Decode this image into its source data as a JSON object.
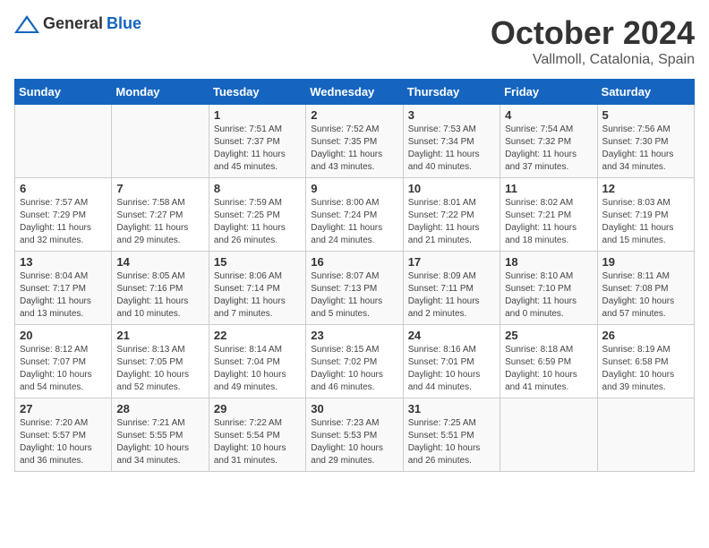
{
  "header": {
    "logo_general": "General",
    "logo_blue": "Blue",
    "month": "October 2024",
    "location": "Vallmoll, Catalonia, Spain"
  },
  "days_of_week": [
    "Sunday",
    "Monday",
    "Tuesday",
    "Wednesday",
    "Thursday",
    "Friday",
    "Saturday"
  ],
  "weeks": [
    [
      {
        "day": "",
        "info": ""
      },
      {
        "day": "",
        "info": ""
      },
      {
        "day": "1",
        "info": "Sunrise: 7:51 AM\nSunset: 7:37 PM\nDaylight: 11 hours and 45 minutes."
      },
      {
        "day": "2",
        "info": "Sunrise: 7:52 AM\nSunset: 7:35 PM\nDaylight: 11 hours and 43 minutes."
      },
      {
        "day": "3",
        "info": "Sunrise: 7:53 AM\nSunset: 7:34 PM\nDaylight: 11 hours and 40 minutes."
      },
      {
        "day": "4",
        "info": "Sunrise: 7:54 AM\nSunset: 7:32 PM\nDaylight: 11 hours and 37 minutes."
      },
      {
        "day": "5",
        "info": "Sunrise: 7:56 AM\nSunset: 7:30 PM\nDaylight: 11 hours and 34 minutes."
      }
    ],
    [
      {
        "day": "6",
        "info": "Sunrise: 7:57 AM\nSunset: 7:29 PM\nDaylight: 11 hours and 32 minutes."
      },
      {
        "day": "7",
        "info": "Sunrise: 7:58 AM\nSunset: 7:27 PM\nDaylight: 11 hours and 29 minutes."
      },
      {
        "day": "8",
        "info": "Sunrise: 7:59 AM\nSunset: 7:25 PM\nDaylight: 11 hours and 26 minutes."
      },
      {
        "day": "9",
        "info": "Sunrise: 8:00 AM\nSunset: 7:24 PM\nDaylight: 11 hours and 24 minutes."
      },
      {
        "day": "10",
        "info": "Sunrise: 8:01 AM\nSunset: 7:22 PM\nDaylight: 11 hours and 21 minutes."
      },
      {
        "day": "11",
        "info": "Sunrise: 8:02 AM\nSunset: 7:21 PM\nDaylight: 11 hours and 18 minutes."
      },
      {
        "day": "12",
        "info": "Sunrise: 8:03 AM\nSunset: 7:19 PM\nDaylight: 11 hours and 15 minutes."
      }
    ],
    [
      {
        "day": "13",
        "info": "Sunrise: 8:04 AM\nSunset: 7:17 PM\nDaylight: 11 hours and 13 minutes."
      },
      {
        "day": "14",
        "info": "Sunrise: 8:05 AM\nSunset: 7:16 PM\nDaylight: 11 hours and 10 minutes."
      },
      {
        "day": "15",
        "info": "Sunrise: 8:06 AM\nSunset: 7:14 PM\nDaylight: 11 hours and 7 minutes."
      },
      {
        "day": "16",
        "info": "Sunrise: 8:07 AM\nSunset: 7:13 PM\nDaylight: 11 hours and 5 minutes."
      },
      {
        "day": "17",
        "info": "Sunrise: 8:09 AM\nSunset: 7:11 PM\nDaylight: 11 hours and 2 minutes."
      },
      {
        "day": "18",
        "info": "Sunrise: 8:10 AM\nSunset: 7:10 PM\nDaylight: 11 hours and 0 minutes."
      },
      {
        "day": "19",
        "info": "Sunrise: 8:11 AM\nSunset: 7:08 PM\nDaylight: 10 hours and 57 minutes."
      }
    ],
    [
      {
        "day": "20",
        "info": "Sunrise: 8:12 AM\nSunset: 7:07 PM\nDaylight: 10 hours and 54 minutes."
      },
      {
        "day": "21",
        "info": "Sunrise: 8:13 AM\nSunset: 7:05 PM\nDaylight: 10 hours and 52 minutes."
      },
      {
        "day": "22",
        "info": "Sunrise: 8:14 AM\nSunset: 7:04 PM\nDaylight: 10 hours and 49 minutes."
      },
      {
        "day": "23",
        "info": "Sunrise: 8:15 AM\nSunset: 7:02 PM\nDaylight: 10 hours and 46 minutes."
      },
      {
        "day": "24",
        "info": "Sunrise: 8:16 AM\nSunset: 7:01 PM\nDaylight: 10 hours and 44 minutes."
      },
      {
        "day": "25",
        "info": "Sunrise: 8:18 AM\nSunset: 6:59 PM\nDaylight: 10 hours and 41 minutes."
      },
      {
        "day": "26",
        "info": "Sunrise: 8:19 AM\nSunset: 6:58 PM\nDaylight: 10 hours and 39 minutes."
      }
    ],
    [
      {
        "day": "27",
        "info": "Sunrise: 7:20 AM\nSunset: 5:57 PM\nDaylight: 10 hours and 36 minutes."
      },
      {
        "day": "28",
        "info": "Sunrise: 7:21 AM\nSunset: 5:55 PM\nDaylight: 10 hours and 34 minutes."
      },
      {
        "day": "29",
        "info": "Sunrise: 7:22 AM\nSunset: 5:54 PM\nDaylight: 10 hours and 31 minutes."
      },
      {
        "day": "30",
        "info": "Sunrise: 7:23 AM\nSunset: 5:53 PM\nDaylight: 10 hours and 29 minutes."
      },
      {
        "day": "31",
        "info": "Sunrise: 7:25 AM\nSunset: 5:51 PM\nDaylight: 10 hours and 26 minutes."
      },
      {
        "day": "",
        "info": ""
      },
      {
        "day": "",
        "info": ""
      }
    ]
  ]
}
